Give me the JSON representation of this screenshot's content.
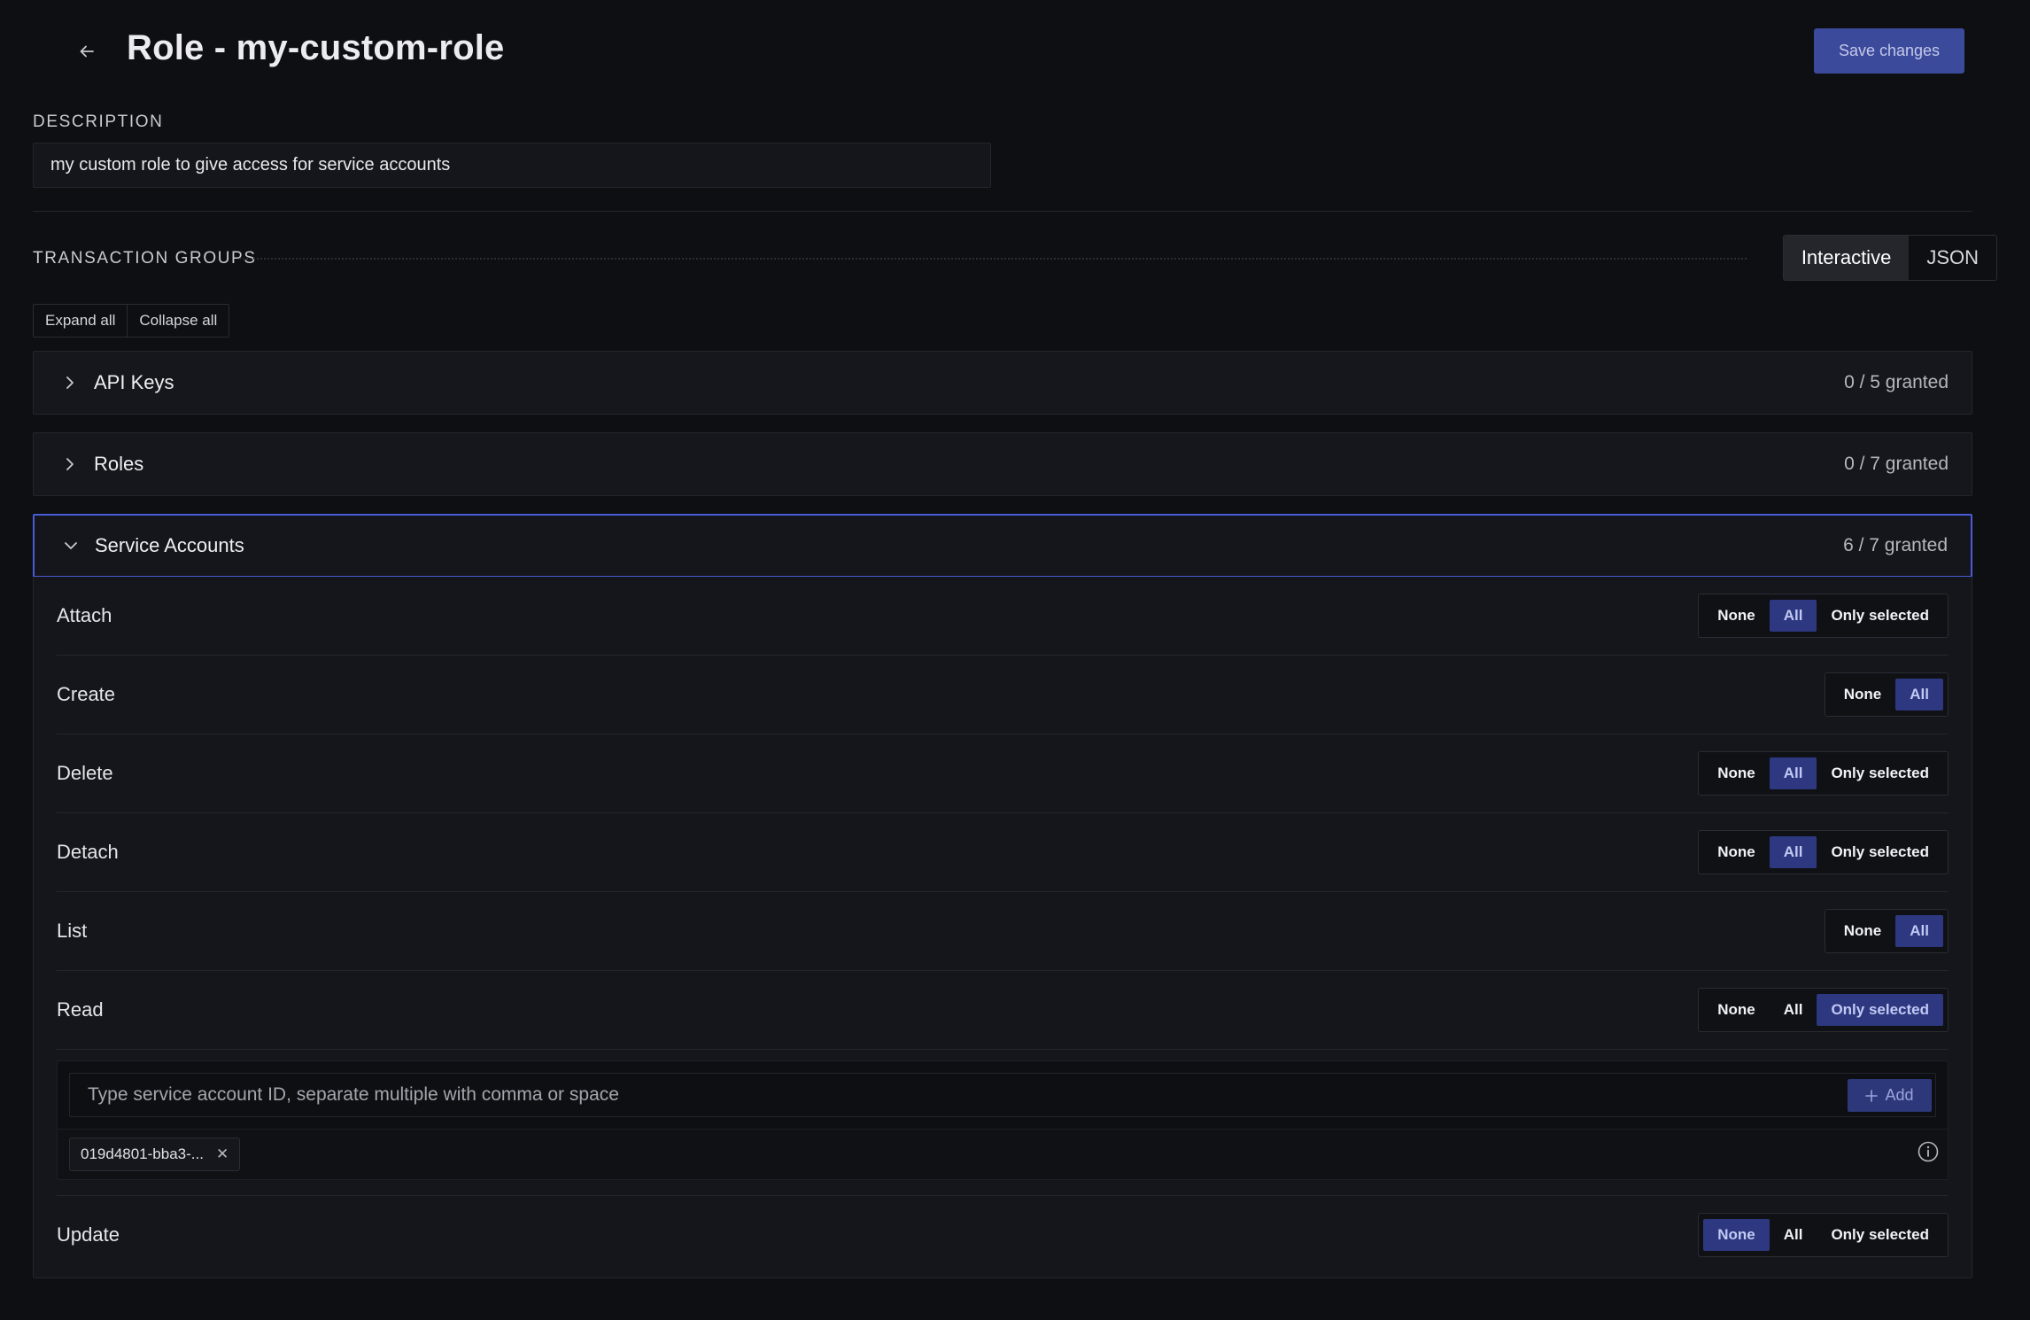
{
  "header": {
    "title": "Role - my-custom-role",
    "save_label": "Save changes"
  },
  "description": {
    "label": "DESCRIPTION",
    "value": "my custom role to give access for service accounts"
  },
  "transaction_groups": {
    "label": "TRANSACTION GROUPS",
    "view_modes": [
      "Interactive",
      "JSON"
    ],
    "active_view": "Interactive",
    "expand_all": "Expand all",
    "collapse_all": "Collapse all"
  },
  "groups": [
    {
      "name": "API Keys",
      "count": "0 / 5 granted",
      "expanded": false
    },
    {
      "name": "Roles",
      "count": "0 / 7 granted",
      "expanded": false
    },
    {
      "name": "Service Accounts",
      "count": "6 / 7 granted",
      "expanded": true
    }
  ],
  "permission_options": {
    "none": "None",
    "all": "All",
    "only_selected": "Only selected"
  },
  "permissions": [
    {
      "name": "Attach",
      "selected": "All",
      "has_only_selected": true
    },
    {
      "name": "Create",
      "selected": "All",
      "has_only_selected": false
    },
    {
      "name": "Delete",
      "selected": "All",
      "has_only_selected": true
    },
    {
      "name": "Detach",
      "selected": "All",
      "has_only_selected": true
    },
    {
      "name": "List",
      "selected": "All",
      "has_only_selected": false
    },
    {
      "name": "Read",
      "selected": "Only selected",
      "has_only_selected": true
    },
    {
      "name": "Update",
      "selected": "None",
      "has_only_selected": true
    }
  ],
  "read_selection": {
    "placeholder": "Type service account ID, separate multiple with comma or space",
    "add_label": "Add",
    "ids": [
      "019d4801-bba3-..."
    ]
  },
  "icons": {
    "back": "arrow-left-icon",
    "collapsed": "chevron-right-icon",
    "expanded": "chevron-down-icon",
    "add": "plus-icon",
    "remove": "close-icon",
    "info": "info-icon"
  },
  "colors": {
    "background": "#0e0f13",
    "panel": "#16171c",
    "accent": "#4a5bd6",
    "selected_option": "#2d3880",
    "save_button": "#3b4a9a"
  }
}
